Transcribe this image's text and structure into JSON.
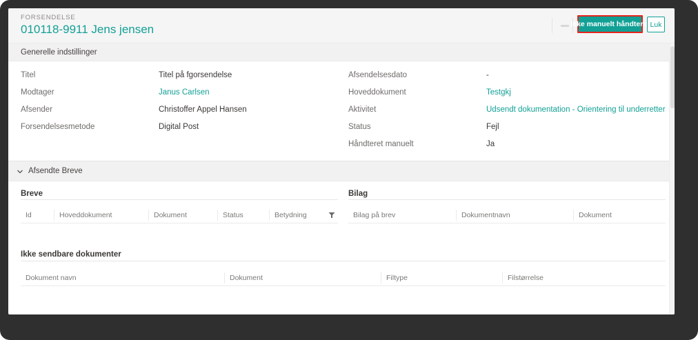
{
  "colors": {
    "accent": "#12a095",
    "highlight_border": "#e5241c",
    "frame": "#2f2f2f"
  },
  "header": {
    "kicker": "FORSENDELSE",
    "title": "010118-9911 Jens jensen",
    "primary_button_label": "Ikke manuelt håndteret",
    "close_button_label": "Luk"
  },
  "general": {
    "section_title": "Generelle indstillinger",
    "left_fields": [
      {
        "label": "Titel",
        "value": "Titel på fgorsendelse"
      },
      {
        "label": "Modtager",
        "value": "Janus Carlsen"
      },
      {
        "label": "Afsender",
        "value": "Christoffer Appel Hansen"
      },
      {
        "label": "Forsendelsesmetode",
        "value": "Digital Post"
      }
    ],
    "right_fields": [
      {
        "label": "Afsendelsesdato",
        "value": "-"
      },
      {
        "label": "Hoveddokument",
        "value": "Testgkj"
      },
      {
        "label": "Aktivitet",
        "value": "Udsendt dokumentation - Orientering til underretter"
      },
      {
        "label": "Status",
        "value": "Fejl"
      },
      {
        "label": "Håndteret manuelt",
        "value": "Ja"
      }
    ]
  },
  "letters": {
    "section_title": "Afsendte Breve",
    "breve": {
      "title": "Breve",
      "columns": [
        "Id",
        "Hoveddokument",
        "Dokument",
        "Status",
        "Betydning"
      ]
    },
    "bilag": {
      "title": "Bilag",
      "columns": [
        "Bilag på brev",
        "Dokumentnavn",
        "Dokument"
      ]
    },
    "unsendable": {
      "title": "Ikke sendbare dokumenter",
      "columns": [
        "Dokument navn",
        "Dokument",
        "Filtype",
        "Filstørrelse"
      ]
    }
  }
}
